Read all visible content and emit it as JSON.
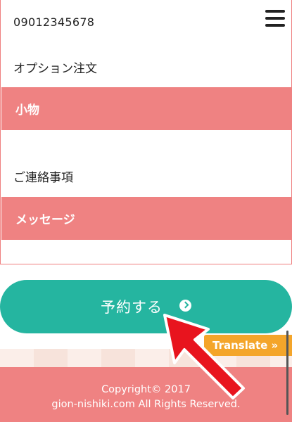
{
  "header": {
    "phone": "09012345678",
    "menu_icon": "hamburger-menu-icon"
  },
  "form": {
    "option_label": "オプション注文",
    "option_field_value": "小物",
    "contact_label": "ご連絡事項",
    "contact_field_value": "メッセージ"
  },
  "actions": {
    "reserve_label": "予約する",
    "reserve_icon": "chevron-right-circle-icon"
  },
  "translate": {
    "label": "Translate »"
  },
  "footer": {
    "copyright": "Copyright© 2017",
    "rights": "gion-nishiki.com All Rights Reserved."
  },
  "colors": {
    "accent_pink": "#ef8282",
    "button_teal": "#25b5a0",
    "translate_orange": "#f4a52a",
    "arrow_red": "#e8141e"
  }
}
